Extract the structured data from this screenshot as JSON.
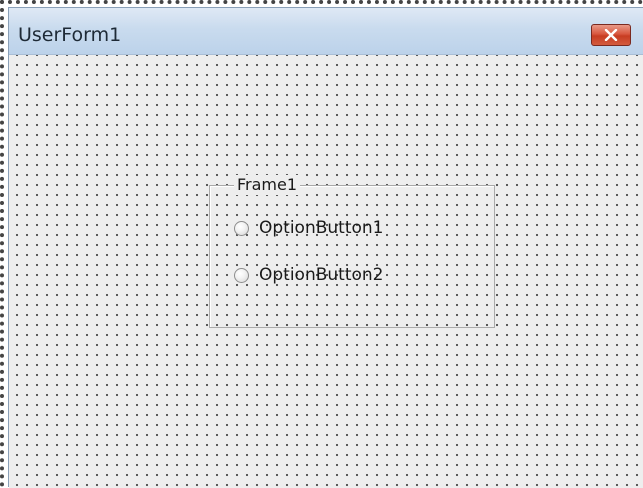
{
  "window": {
    "title": "UserForm1",
    "close_icon": "close-icon",
    "accent": "#c73d22"
  },
  "frame": {
    "caption": "Frame1",
    "options": [
      {
        "label": "OptionButton1",
        "selected": false
      },
      {
        "label": "OptionButton2",
        "selected": false
      }
    ]
  }
}
